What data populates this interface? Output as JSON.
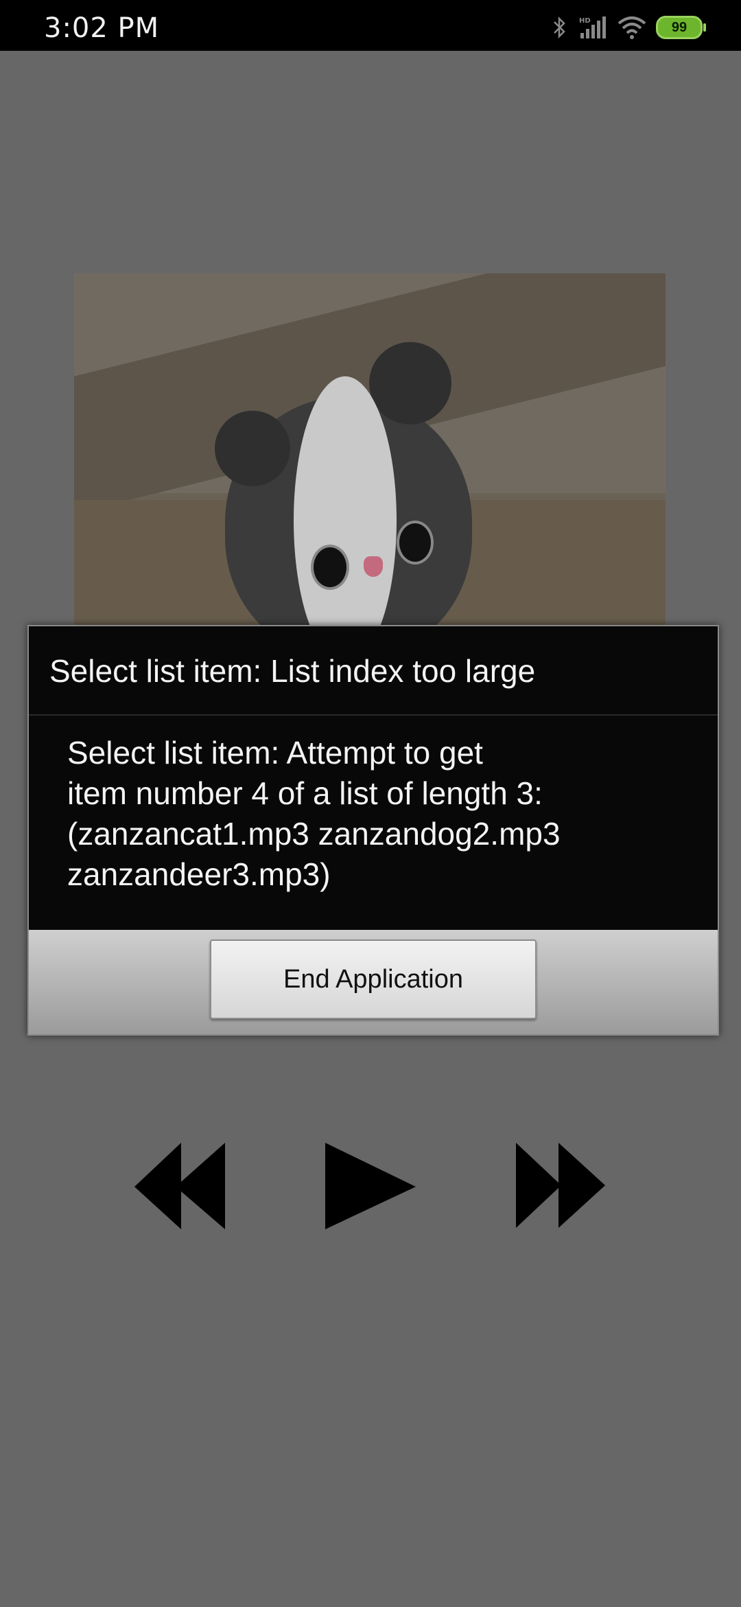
{
  "status_bar": {
    "time": "3:02 PM",
    "battery": "99",
    "icons": [
      "bluetooth-icon",
      "hd-signal-icon",
      "wifi-icon",
      "battery-icon"
    ]
  },
  "dialog": {
    "title": "Select list item: List index too large",
    "message": "Select list item: Attempt to get\nitem number 4 of a list of length 3:\n(zanzancat1.mp3 zanzandog2.mp3\nzanzandeer3.mp3)",
    "button_label": "End Application"
  },
  "controls": [
    "rewind-icon",
    "play-icon",
    "fast-forward-icon"
  ],
  "colors": {
    "background": "#676767",
    "dialog_background": "#080808",
    "battery": "#6cb52c"
  }
}
